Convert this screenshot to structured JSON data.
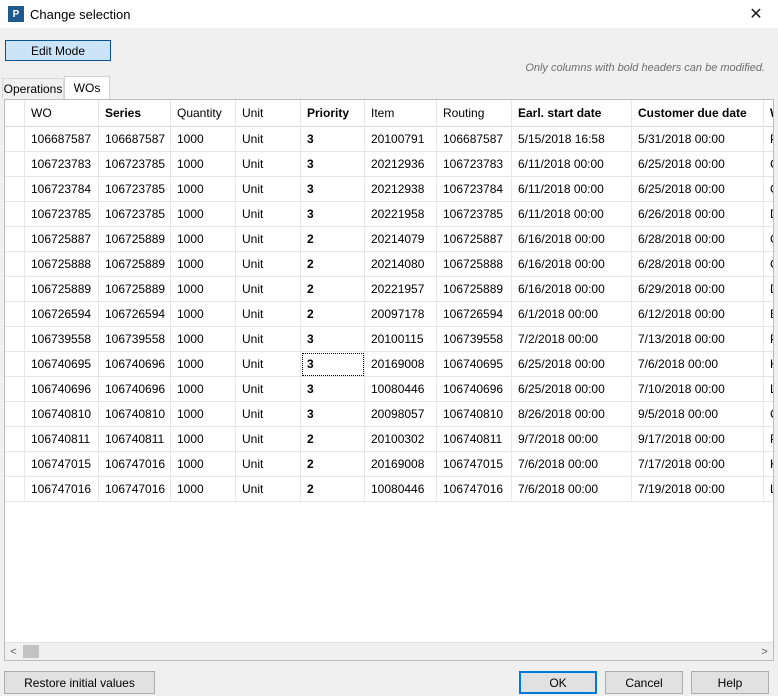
{
  "window": {
    "title": "Change selection",
    "app_icon_letter": "P",
    "close_symbol": "✕"
  },
  "toolbar": {
    "edit_mode_label": "Edit Mode"
  },
  "hint": "Only columns with bold headers can be modified.",
  "tabs": [
    {
      "label": "Operations"
    },
    {
      "label": "WOs"
    }
  ],
  "grid": {
    "headers": [
      "WO",
      "Series",
      "Quantity",
      "Unit",
      "Priority",
      "Item",
      "Routing",
      "Earl. start date",
      "Customer due date",
      "W"
    ],
    "rows": [
      [
        "106687587",
        "106687587",
        "1000",
        "Unit",
        "3",
        "20100791",
        "106687587",
        "5/15/2018 16:58",
        "5/31/2018 00:00",
        "P"
      ],
      [
        "106723783",
        "106723785",
        "1000",
        "Unit",
        "3",
        "20212936",
        "106723783",
        "6/11/2018 00:00",
        "6/25/2018 00:00",
        "C"
      ],
      [
        "106723784",
        "106723785",
        "1000",
        "Unit",
        "3",
        "20212938",
        "106723784",
        "6/11/2018 00:00",
        "6/25/2018 00:00",
        "C"
      ],
      [
        "106723785",
        "106723785",
        "1000",
        "Unit",
        "3",
        "20221958",
        "106723785",
        "6/11/2018 00:00",
        "6/26/2018 00:00",
        "D"
      ],
      [
        "106725887",
        "106725889",
        "1000",
        "Unit",
        "2",
        "20214079",
        "106725887",
        "6/16/2018 00:00",
        "6/28/2018 00:00",
        "C"
      ],
      [
        "106725888",
        "106725889",
        "1000",
        "Unit",
        "2",
        "20214080",
        "106725888",
        "6/16/2018 00:00",
        "6/28/2018 00:00",
        "C"
      ],
      [
        "106725889",
        "106725889",
        "1000",
        "Unit",
        "2",
        "20221957",
        "106725889",
        "6/16/2018 00:00",
        "6/29/2018 00:00",
        "D"
      ],
      [
        "106726594",
        "106726594",
        "1000",
        "Unit",
        "2",
        "20097178",
        "106726594",
        "6/1/2018 00:00",
        "6/12/2018 00:00",
        "E"
      ],
      [
        "106739558",
        "106739558",
        "1000",
        "Unit",
        "3",
        "20100115",
        "106739558",
        "7/2/2018 00:00",
        "7/13/2018 00:00",
        "P"
      ],
      [
        "106740695",
        "106740696",
        "1000",
        "Unit",
        "3",
        "20169008",
        "106740695",
        "6/25/2018 00:00",
        "7/6/2018 00:00",
        "K"
      ],
      [
        "106740696",
        "106740696",
        "1000",
        "Unit",
        "3",
        "10080446",
        "106740696",
        "6/25/2018 00:00",
        "7/10/2018 00:00",
        "L"
      ],
      [
        "106740810",
        "106740810",
        "1000",
        "Unit",
        "3",
        "20098057",
        "106740810",
        "8/26/2018 00:00",
        "9/5/2018 00:00",
        "C"
      ],
      [
        "106740811",
        "106740811",
        "1000",
        "Unit",
        "2",
        "20100302",
        "106740811",
        "9/7/2018 00:00",
        "9/17/2018 00:00",
        "P"
      ],
      [
        "106747015",
        "106747016",
        "1000",
        "Unit",
        "2",
        "20169008",
        "106747015",
        "7/6/2018 00:00",
        "7/17/2018 00:00",
        "K"
      ],
      [
        "106747016",
        "106747016",
        "1000",
        "Unit",
        "2",
        "10080446",
        "106747016",
        "7/6/2018 00:00",
        "7/19/2018 00:00",
        "L"
      ]
    ]
  },
  "scrollbar": {
    "left_symbol": "<",
    "right_symbol": ">"
  },
  "buttons": {
    "restore": "Restore initial values",
    "ok": "OK",
    "cancel": "Cancel",
    "help": "Help"
  }
}
